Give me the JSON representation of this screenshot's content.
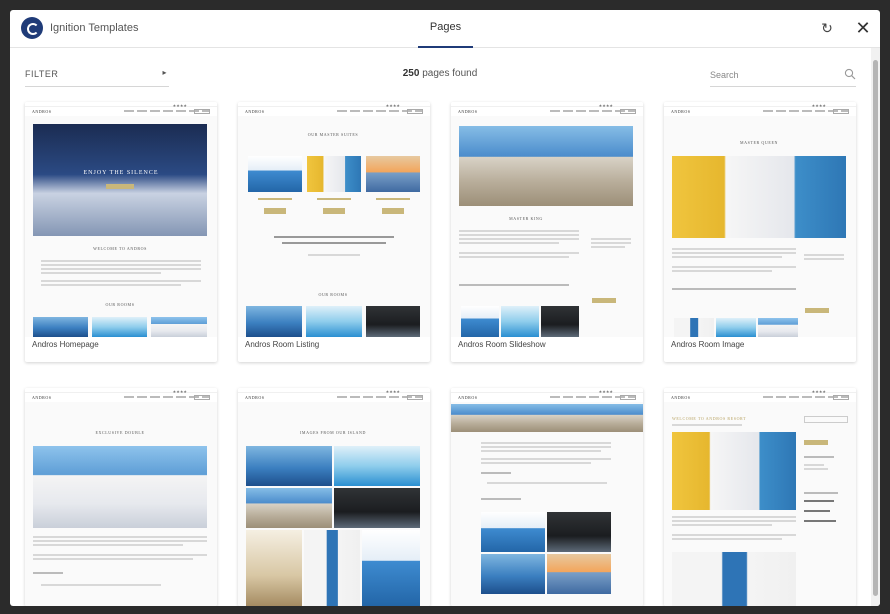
{
  "header": {
    "app_title": "Ignition Templates",
    "tab_label": "Pages",
    "refresh_icon": "refresh-icon",
    "close_icon": "close-icon"
  },
  "toolbar": {
    "filter_label": "FILTER",
    "count_number": "250",
    "count_suffix": " pages found",
    "search_placeholder": "Search"
  },
  "colors": {
    "accent": "#1f3b78",
    "gold": "#c9b77a"
  },
  "cards": [
    {
      "name": "Andros Homepage",
      "brand": "ANDROS",
      "cover_text": "ENJOY THE SILENCE",
      "heading": "WELCOME TO ANDROS",
      "heading2": "OUR ROOMS"
    },
    {
      "name": "Andros Room Listing",
      "brand": "ANDROS",
      "heading": "OUR MASTER SUITES",
      "heading2": "OUR ROOMS"
    },
    {
      "name": "Andros Room Slideshow",
      "brand": "ANDROS",
      "heading": "MASTER KING"
    },
    {
      "name": "Andros Room Image",
      "brand": "ANDROS",
      "heading": "MASTER QUEEN"
    },
    {
      "name": "",
      "brand": "ANDROS",
      "heading": "EXCLUSIVE DOUBLE"
    },
    {
      "name": "",
      "brand": "ANDROS",
      "heading": "IMAGES FROM OUR ISLAND"
    },
    {
      "name": "",
      "brand": "ANDROS",
      "heading": ""
    },
    {
      "name": "",
      "brand": "ANDROS",
      "heading": "WELCOME TO ANDROS RESORT"
    }
  ]
}
